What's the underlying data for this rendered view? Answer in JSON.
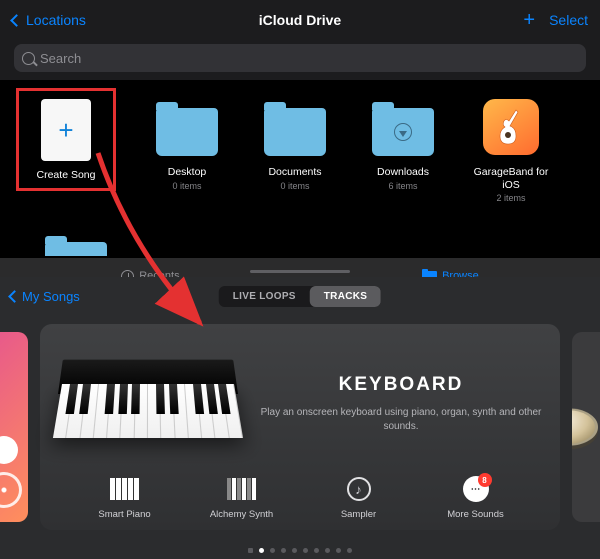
{
  "files": {
    "back_label": "Locations",
    "title": "iCloud Drive",
    "select_label": "Select",
    "search_placeholder": "Search",
    "items": [
      {
        "label": "Create Song",
        "sub": ""
      },
      {
        "label": "Desktop",
        "sub": "0 items"
      },
      {
        "label": "Documents",
        "sub": "0 items"
      },
      {
        "label": "Downloads",
        "sub": "6 items"
      },
      {
        "label": "GarageBand for iOS",
        "sub": "2 items"
      }
    ],
    "tabs": {
      "recents": "Recents",
      "browse": "Browse"
    }
  },
  "gb": {
    "back_label": "My Songs",
    "segments": {
      "liveloops": "LIVE LOOPS",
      "tracks": "TRACKS"
    },
    "card": {
      "title": "KEYBOARD",
      "desc": "Play an onscreen keyboard using piano, organ, synth and other sounds."
    },
    "sub": [
      {
        "label": "Smart Piano"
      },
      {
        "label": "Alchemy Synth"
      },
      {
        "label": "Sampler"
      },
      {
        "label": "More Sounds",
        "badge": "8"
      }
    ]
  }
}
